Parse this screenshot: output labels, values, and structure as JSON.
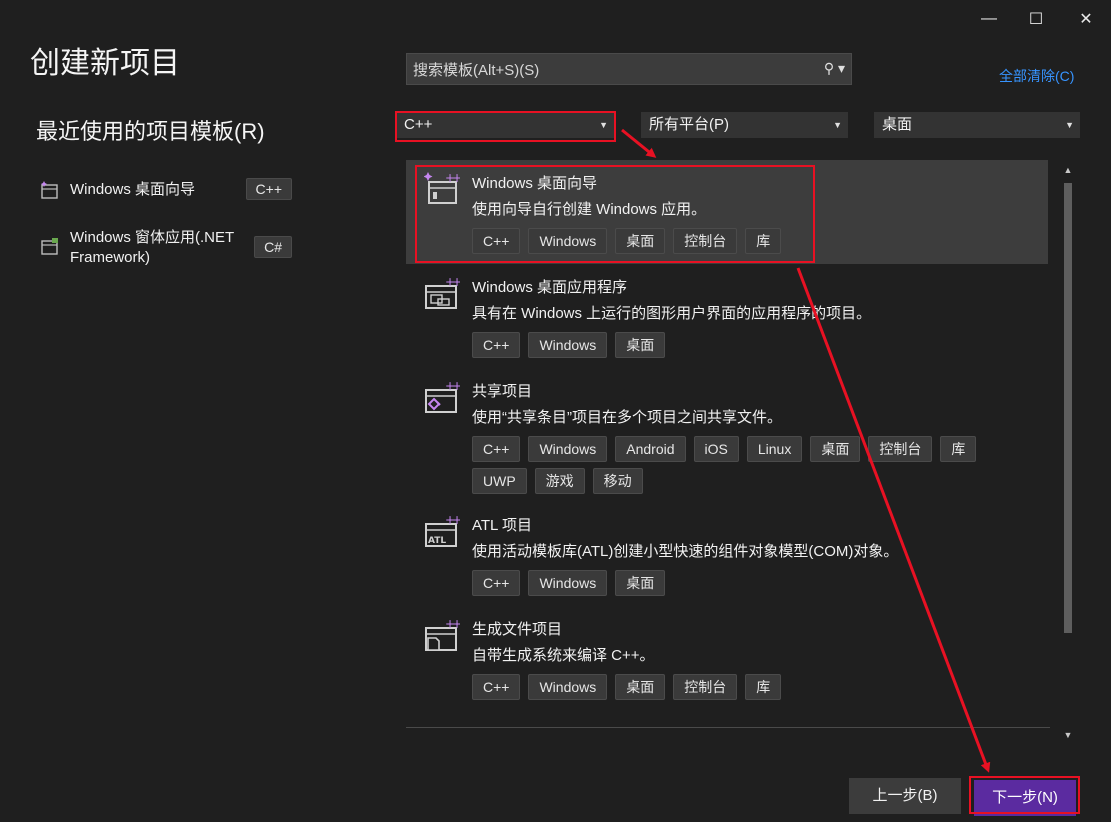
{
  "window": {
    "minimize_glyph": "—",
    "maximize_glyph": "☐",
    "close_glyph": "✕"
  },
  "title": "创建新项目",
  "recent": {
    "heading": "最近使用的项目模板(R)",
    "items": [
      {
        "name": "Windows 桌面向导",
        "lang": "C++",
        "icon": "wizard-icon"
      },
      {
        "name": "Windows 窗体应用(.NET Framework)",
        "lang": "C#",
        "icon": "winforms-icon"
      }
    ]
  },
  "search": {
    "placeholder": "搜索模板(Alt+S)(S)",
    "icon": "search-icon"
  },
  "clear_all": "全部清除(C)",
  "filters": {
    "language": "C++",
    "platform": "所有平台(P)",
    "project_type": "桌面"
  },
  "templates": [
    {
      "name": "Windows 桌面向导",
      "description": "使用向导自行创建 Windows 应用。",
      "tags": [
        "C++",
        "Windows",
        "桌面",
        "控制台",
        "库"
      ],
      "icon": "desktop-wizard-icon",
      "selected": true
    },
    {
      "name": "Windows 桌面应用程序",
      "description": "具有在 Windows 上运行的图形用户界面的应用程序的项目。",
      "tags": [
        "C++",
        "Windows",
        "桌面"
      ],
      "icon": "desktop-app-icon"
    },
    {
      "name": "共享项目",
      "description": "使用“共享条目”项目在多个项目之间共享文件。",
      "tags": [
        "C++",
        "Windows",
        "Android",
        "iOS",
        "Linux",
        "桌面",
        "控制台",
        "库",
        "UWP",
        "游戏",
        "移动"
      ],
      "icon": "shared-project-icon"
    },
    {
      "name": "ATL 项目",
      "description": "使用活动模板库(ATL)创建小型快速的组件对象模型(COM)对象。",
      "tags": [
        "C++",
        "Windows",
        "桌面"
      ],
      "icon": "atl-project-icon",
      "icon_label": "ATL"
    },
    {
      "name": "生成文件项目",
      "description": "自带生成系统来编译 C++。",
      "tags": [
        "C++",
        "Windows",
        "桌面",
        "控制台",
        "库"
      ],
      "icon": "makefile-project-icon"
    }
  ],
  "buttons": {
    "back": "上一步(B)",
    "next": "下一步(N)"
  },
  "colors": {
    "accent": "#5b2ba0",
    "link": "#3794ff",
    "highlight_annotation": "#e81123",
    "icon_plus": "#c586f0"
  }
}
